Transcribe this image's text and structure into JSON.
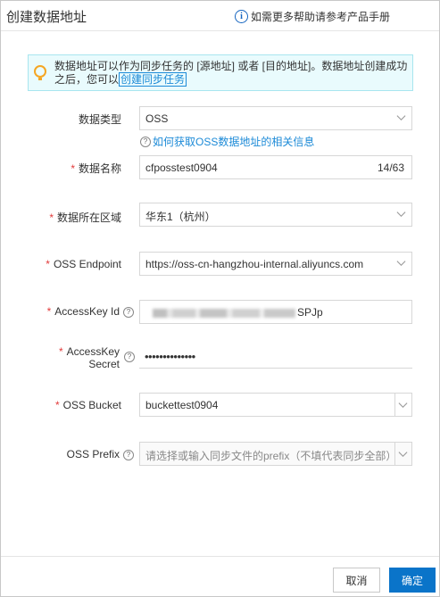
{
  "dialog": {
    "title": "创建数据地址",
    "help_text": "如需更多帮助请参考产品手册"
  },
  "tip": {
    "text": "数据地址可以作为同步任务的 [源地址] 或者 [目的地址]。数据地址创建成功之后，您可以",
    "link": "创建同步任务"
  },
  "form": {
    "data_type": {
      "label": "数据类型",
      "value": "OSS",
      "help_link": "如何获取OSS数据地址的相关信息"
    },
    "data_name": {
      "label": "数据名称",
      "value": "cfposstest0904",
      "counter": "14/63"
    },
    "region": {
      "label": "数据所在区域",
      "value": "华东1（杭州）"
    },
    "endpoint": {
      "label": "OSS Endpoint",
      "value": "https://oss-cn-hangzhou-internal.aliyuncs.com"
    },
    "access_key_id": {
      "label": "AccessKey Id",
      "value_suffix": "SPJp"
    },
    "access_key_secret": {
      "label_line1": "AccessKey",
      "label_line2": "Secret",
      "value": "••••••••••••••"
    },
    "bucket": {
      "label": "OSS Bucket",
      "value": "buckettest0904"
    },
    "prefix": {
      "label": "OSS Prefix",
      "placeholder": "请选择或输入同步文件的prefix（不填代表同步全部）"
    }
  },
  "footer": {
    "cancel_label": "取消",
    "ok_label": "确定"
  },
  "colors": {
    "link": "#1c8ad7",
    "primary": "#0a74c9",
    "required": "#e23a3a",
    "tip_bg": "#e9fbfd"
  },
  "icons": [
    "info-icon",
    "lightbulb-icon",
    "question-circle-icon",
    "chevron-down-icon"
  ]
}
